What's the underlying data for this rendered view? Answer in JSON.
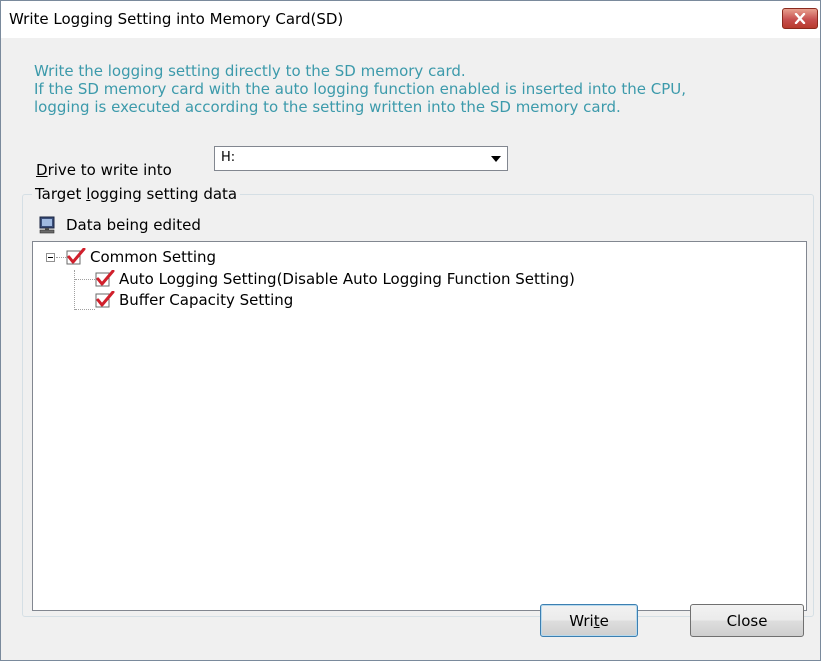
{
  "window": {
    "title": "Write Logging Setting into Memory Card(SD)"
  },
  "description": {
    "line1": "Write the logging setting directly to the SD memory card.",
    "line2": "If the SD memory card with the auto logging function enabled is inserted into the CPU,",
    "line3": "logging is executed according to the setting written into the SD memory card."
  },
  "drive": {
    "label_accel": "D",
    "label_rest": "rive to write into",
    "selected": "H:"
  },
  "target_group": {
    "legend_pre": "Target ",
    "legend_accel": "l",
    "legend_post": "ogging setting data",
    "source_label": "Data being edited"
  },
  "tree": {
    "root": {
      "label": "Common Setting",
      "checked": true,
      "expanded": true
    },
    "children": [
      {
        "label": "Auto Logging Setting(Disable Auto Logging Function Setting)",
        "checked": true
      },
      {
        "label": "Buffer Capacity Setting",
        "checked": true
      }
    ]
  },
  "buttons": {
    "write_pre": "Wri",
    "write_accel": "t",
    "write_post": "e",
    "close": "Close"
  },
  "colors": {
    "description_text": "#3c9aab",
    "check_mark": "#d0202c",
    "close_button": "#c75050"
  }
}
